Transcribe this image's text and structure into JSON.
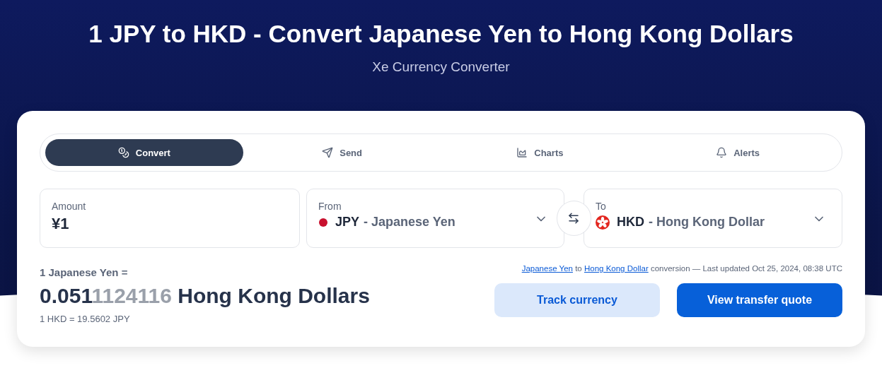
{
  "header": {
    "title": "1 JPY to HKD - Convert Japanese Yen to Hong Kong Dollars",
    "subtitle": "Xe Currency Converter"
  },
  "tabs": [
    {
      "label": "Convert",
      "selected": true
    },
    {
      "label": "Send",
      "selected": false
    },
    {
      "label": "Charts",
      "selected": false
    },
    {
      "label": "Alerts",
      "selected": false
    }
  ],
  "amount": {
    "label": "Amount",
    "value": "¥1"
  },
  "from": {
    "label": "From",
    "code": "JPY",
    "name": "- Japanese Yen"
  },
  "to": {
    "label": "To",
    "code": "HKD",
    "name": "- Hong Kong Dollar"
  },
  "result": {
    "base": "1 Japanese Yen =",
    "main": "0.051",
    "faded": "1124116",
    "unit": "Hong Kong Dollars",
    "inverse": "1 HKD = 19.5602 JPY"
  },
  "update_note": {
    "link_1": "Japanese Yen",
    "between": "to",
    "link_2": "Hong Kong Dollar",
    "rest": "conversion — Last updated Oct 25, 2024, 08:38 UTC"
  },
  "buttons": {
    "track": "Track currency",
    "quote": "View transfer quote"
  }
}
